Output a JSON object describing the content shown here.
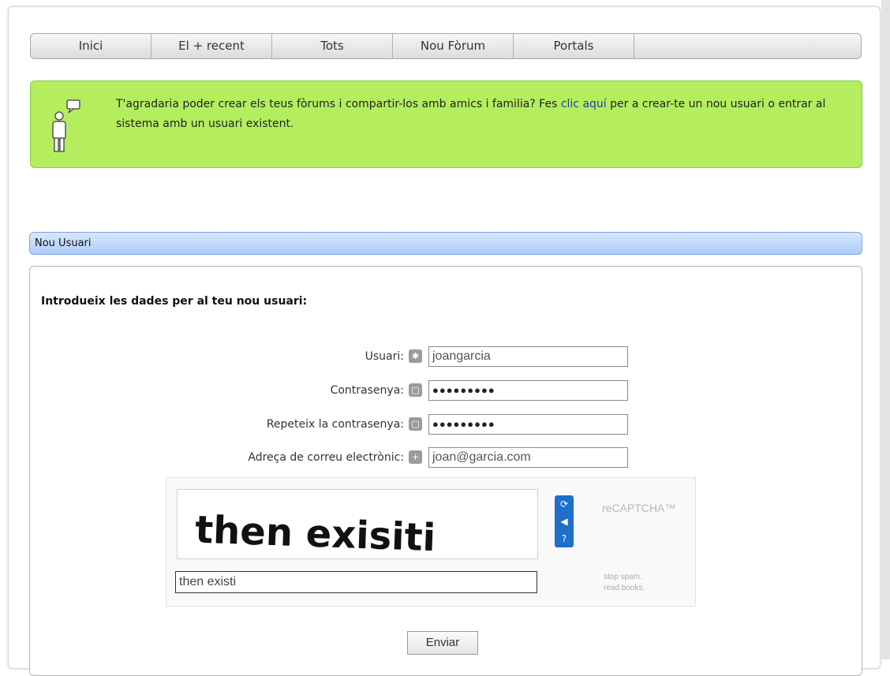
{
  "nav": {
    "tabs": [
      "Inici",
      "El + recent",
      "Tots",
      "Nou Fòrum",
      "Portals"
    ]
  },
  "banner": {
    "text_before": "T'agradaria poder crear els teus fòrums i compartir-los amb amics i familia? Fes ",
    "link": "clic aquí",
    "text_after": " per a crear-te un nou usuari o entrar al sistema amb un usuari existent."
  },
  "section": {
    "title": "Nou Usuari",
    "intro": "Introdueix les dades per al teu nou usuari:"
  },
  "form": {
    "username_label": "Usuari:",
    "username_value": "joangarcia",
    "password_label": "Contrasenya:",
    "password_value": "●●●●●●●●●",
    "repeat_label": "Repeteix la contrasenya:",
    "repeat_value": "●●●●●●●●●",
    "email_label": "Adreça de correu electrònic:",
    "email_value": "joan@garcia.com",
    "submit_label": "Enviar"
  },
  "captcha": {
    "image_text": "then exisiti",
    "answer_value": "then existi",
    "logo": "reCAPTCHA™",
    "tagline_1": "stop spam.",
    "tagline_2": "read books."
  }
}
